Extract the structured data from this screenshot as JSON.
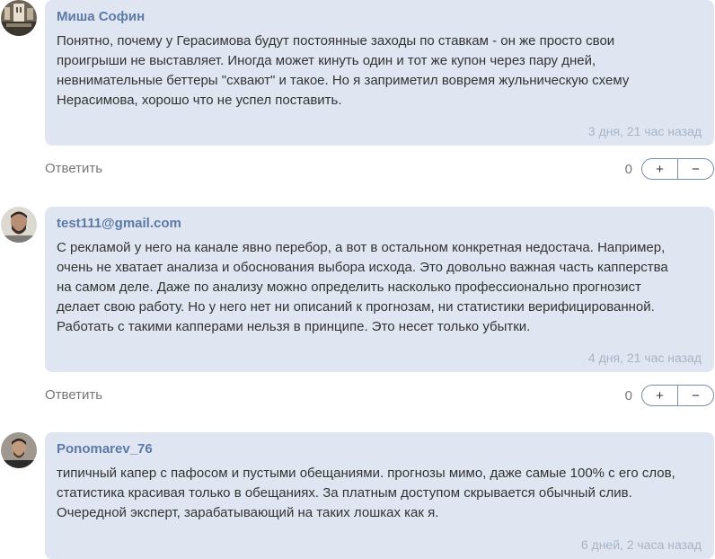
{
  "comments": [
    {
      "author": "Миша Софин",
      "text": "Понятно, почему у Герасимова будут постоянные заходы по ставкам - он же просто свои\nпроигрыши не выставляет. Иногда может кинуть один и тот же купон через пару дней,\nневнимательные беттеры \"схвают\" и такое. Но я заприметил вовремя жульническую схему\nНерасимова, хорошо что не успел поставить.",
      "time": "3 дня, 21 час назад",
      "reply_label": "Ответить",
      "votes": "0",
      "plus_label": "+",
      "minus_label": "−"
    },
    {
      "author": "test111@gmail.com",
      "text": "С рекламой у него на канале явно перебор, а вот в остальном конкретная недостача. Например,\nочень не хватает анализа и обоснования выбора исхода. Это довольно важная часть капперства\nна самом деле. Даже по анализу можно определить насколько профессионально прогнозист\nделает свою работу. Но у него нет ни описаний к прогнозам, ни статистики верифицированной.\nРаботать с такими капперами нельзя в принципе. Это несет только убытки.",
      "time": "4 дня, 21 час назад",
      "reply_label": "Ответить",
      "votes": "0",
      "plus_label": "+",
      "minus_label": "−"
    },
    {
      "author": "Ponomarev_76",
      "text": "типичный капер с пафосом и пустыми обещаниями. прогнозы мимо, даже самые 100% с его слов,\nстатистика красивая только в обещаниях. За платным доступом скрывается обычный слив.\nОчередной эксперт, зарабатывающий на таких лошках как я.",
      "time": "6 дней, 2 часа назад"
    }
  ]
}
